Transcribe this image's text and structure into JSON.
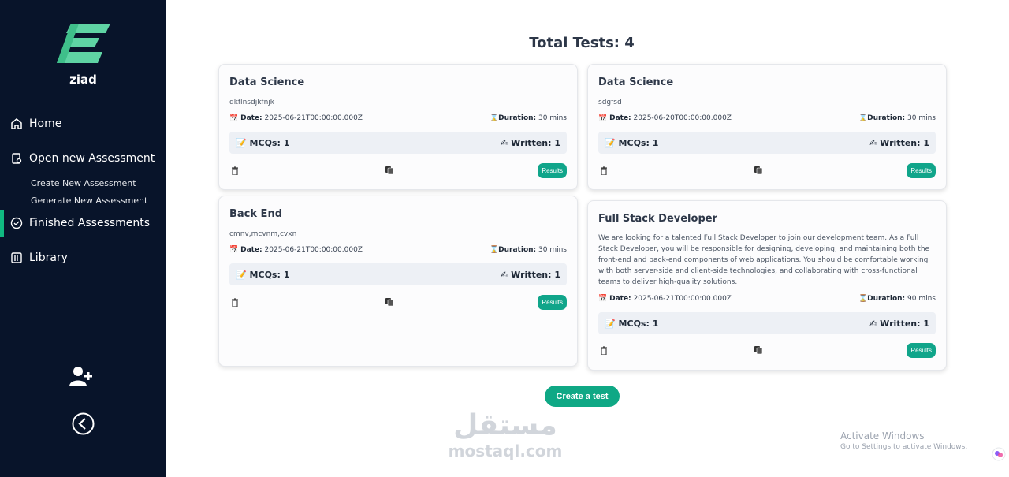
{
  "sidebar": {
    "brand": "ziad",
    "items": [
      {
        "label": "Home"
      },
      {
        "label": "Open new Assessment"
      },
      {
        "label": "Finished Assessments"
      },
      {
        "label": "Library"
      }
    ],
    "sub_items": [
      {
        "label": "Create New Assessment"
      },
      {
        "label": "Generate New Assessment"
      }
    ]
  },
  "main": {
    "title": "Total Tests: 4",
    "create_label": "Create a test",
    "cards": [
      {
        "title": "Data Science",
        "description": "dkflnsdjkfnjk",
        "date_label": "Date:",
        "date": "2025-06-21T00:00:00.000Z",
        "duration_label": "Duration:",
        "duration": "30 mins",
        "mcq_label": "MCQs: 1",
        "written_label": "Written: 1",
        "results_label": "Results"
      },
      {
        "title": "Data Science",
        "description": "sdgfsd",
        "date_label": "Date:",
        "date": "2025-06-20T00:00:00.000Z",
        "duration_label": "Duration:",
        "duration": "30 mins",
        "mcq_label": "MCQs: 1",
        "written_label": "Written: 1",
        "results_label": "Results"
      },
      {
        "title": "Back End",
        "description": "cmnv,mcvnm,cvxn",
        "date_label": "Date:",
        "date": "2025-06-21T00:00:00.000Z",
        "duration_label": "Duration:",
        "duration": "30 mins",
        "mcq_label": "MCQs: 1",
        "written_label": "Written: 1",
        "results_label": "Results"
      },
      {
        "title": "Full Stack Developer",
        "description": "We are looking for a talented Full Stack Developer to join our development team. As a Full Stack Developer, you will be responsible for designing, developing, and maintaining both the front-end and back-end components of web applications. You should be comfortable working with both server-side and client-side technologies, and collaborating with cross-functional teams to deliver high-quality solutions.",
        "date_label": "Date:",
        "date": "2025-06-21T00:00:00.000Z",
        "duration_label": "Duration:",
        "duration": "90 mins",
        "mcq_label": "MCQs: 1",
        "written_label": "Written: 1",
        "results_label": "Results"
      }
    ]
  },
  "watermark": {
    "arabic": "مستقل",
    "latin": "mostaql.com"
  },
  "os_overlay": {
    "line1": "Activate Windows",
    "line2": "Go to Settings to activate Windows."
  },
  "colors": {
    "sidebar_bg": "#08142a",
    "accent": "#10a58a",
    "logo": "#5fd4a4"
  },
  "icons": [
    "home-icon",
    "assessment-icon",
    "check-circle-icon",
    "library-icon",
    "add-user-icon",
    "back-icon",
    "calendar-icon",
    "hourglass-icon",
    "memo-icon",
    "pencil-icon",
    "trash-icon",
    "copy-icon"
  ]
}
